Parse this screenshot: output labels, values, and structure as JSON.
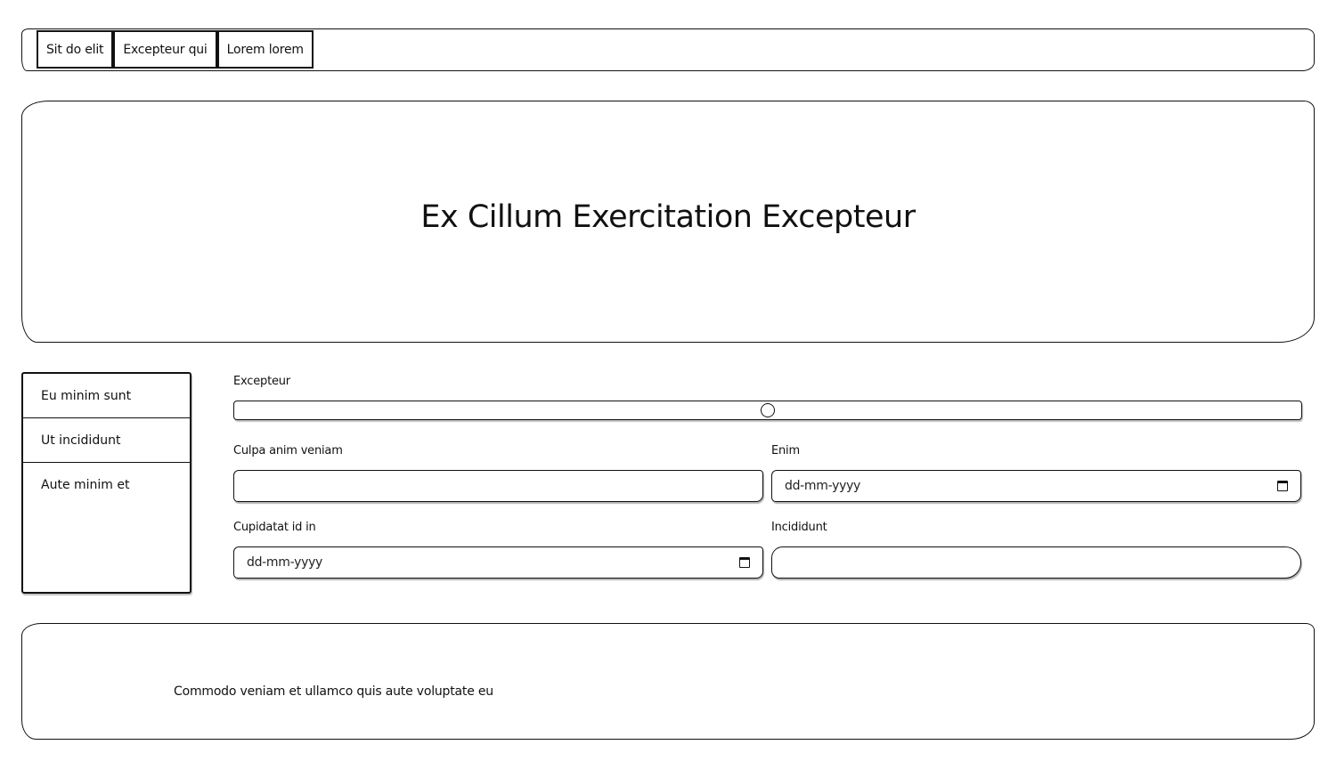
{
  "nav": {
    "tabs": [
      {
        "label": "Sit do elit"
      },
      {
        "label": "Excepteur qui"
      },
      {
        "label": "Lorem lorem"
      }
    ]
  },
  "hero": {
    "title": "Ex Cillum Exercitation Excepteur"
  },
  "sidebar": {
    "items": [
      {
        "label": "Eu minim sunt"
      },
      {
        "label": "Ut incididunt"
      },
      {
        "label": "Aute minim et"
      }
    ]
  },
  "form": {
    "slider": {
      "label": "Excepteur",
      "value_fraction": 0.5
    },
    "culpa": {
      "label": "Culpa anim veniam",
      "value": ""
    },
    "enim": {
      "label": "Enim",
      "placeholder": "dd-mm-yyyy"
    },
    "cupidatat": {
      "label": "Cupidatat id in",
      "placeholder": "dd-mm-yyyy"
    },
    "incididunt": {
      "label": "Incididunt",
      "value": ""
    }
  },
  "footer": {
    "text": "Commodo veniam et ullamco quis aute voluptate eu"
  }
}
